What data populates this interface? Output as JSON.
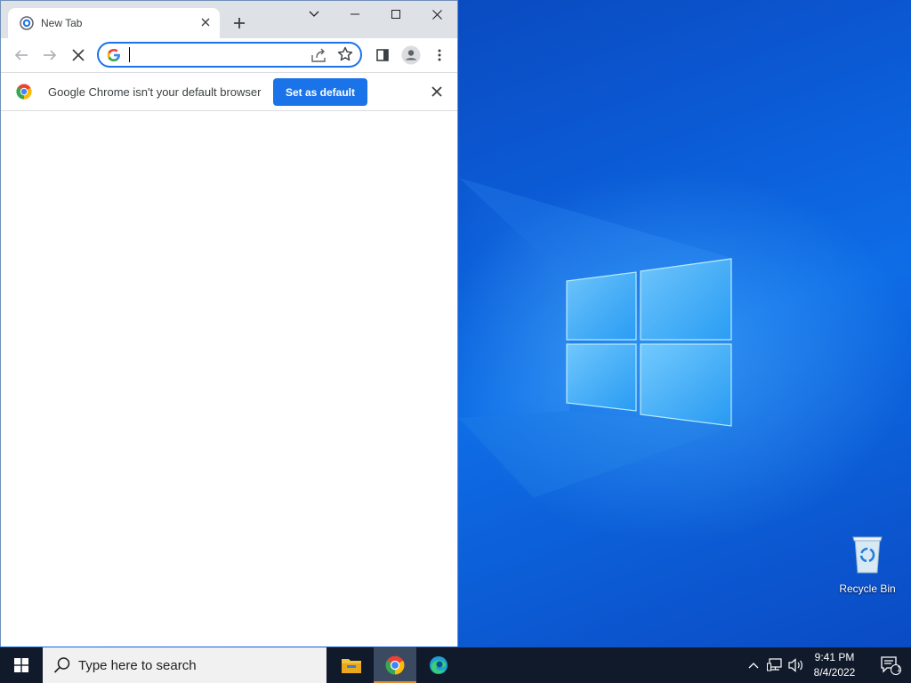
{
  "desktop": {
    "icons": [
      {
        "label": "Recycle Bin",
        "icon": "recycle-bin-icon"
      }
    ]
  },
  "chrome": {
    "tab": {
      "title": "New Tab",
      "favicon": "new-tab-icon"
    },
    "new_tab_label": "+",
    "window_controls": [
      "tab-search",
      "minimize",
      "maximize",
      "close"
    ],
    "omnibox": {
      "value": "",
      "placeholder": ""
    },
    "infobar": {
      "message": "Google Chrome isn't your default browser",
      "button_label": "Set as default"
    }
  },
  "taskbar": {
    "search_placeholder": "Type here to search",
    "apps": [
      "file-explorer",
      "google-chrome",
      "microsoft-edge"
    ],
    "clock": {
      "time": "9:41 PM",
      "date": "8/4/2022"
    },
    "notification_count": "1"
  },
  "colors": {
    "accent": "#1a73e8",
    "taskbar": "#101a2b",
    "titlebar": "#dee1e6",
    "active_app_underline": "#e08a2c"
  }
}
